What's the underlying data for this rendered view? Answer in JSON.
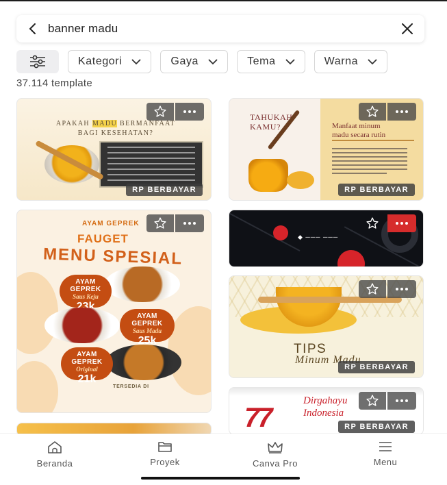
{
  "search": {
    "query": "banner madu"
  },
  "filters": [
    {
      "label": "Kategori"
    },
    {
      "label": "Gaya"
    },
    {
      "label": "Tema"
    },
    {
      "label": "Warna"
    }
  ],
  "results": {
    "count_label": "37.114 template"
  },
  "templates": {
    "badge_label": "RP BERBAYAR",
    "card1": {
      "title_a": "APAKAH ",
      "title_highlight": "MADU",
      "title_b": " BERMANFAAT",
      "title_line2": "BAGI KESEHATAN?"
    },
    "card2": {
      "title_line1": "TAHUKAH",
      "title_line2": "KAMU?",
      "sub_line1": "Manfaat minum",
      "sub_line2": "madu secara rutin"
    },
    "card3": {
      "brand_top": "AYAM GEPREK",
      "brand_name": "FAUGET",
      "headline": "MENU SPESIAL",
      "items": [
        {
          "name_1": "AYAM",
          "name_2": "GEPREK",
          "sauce": "Saus Keju",
          "price": "23k"
        },
        {
          "name_1": "AYAM",
          "name_2": "GEPREK",
          "sauce": "Saus Madu",
          "price": "25k"
        },
        {
          "name_1": "AYAM",
          "name_2": "GEPREK",
          "sauce": "Original",
          "price": "21k"
        }
      ],
      "footer": "TERSEDIA DI"
    },
    "card5": {
      "title": "TIPS",
      "subtitle": "Minum Madu"
    },
    "card6": {
      "number": "77",
      "script_1": "Dirgahayu",
      "script_2": "Indonesia"
    }
  },
  "bottom_nav": [
    {
      "label": "Beranda",
      "icon": "home-icon"
    },
    {
      "label": "Proyek",
      "icon": "folder-icon"
    },
    {
      "label": "Canva Pro",
      "icon": "crown-icon"
    },
    {
      "label": "Menu",
      "icon": "menu-icon"
    }
  ],
  "colors": {
    "accent_red": "#d62c2c",
    "badge_bg": "#3c3c3c"
  }
}
